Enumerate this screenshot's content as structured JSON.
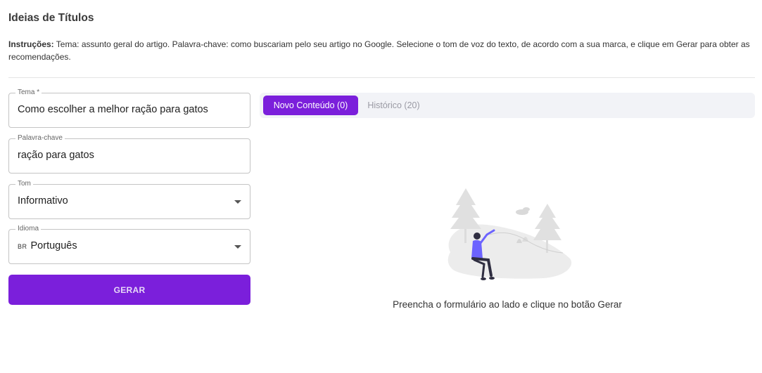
{
  "page": {
    "title": "Ideias de Títulos",
    "instructions_label": "Instruções:",
    "instructions_text": " Tema: assunto geral do artigo. Palavra-chave: como buscariam pelo seu artigo no Google. Selecione o tom de voz do texto, de acordo com a sua marca, e clique em Gerar para obter as recomendações."
  },
  "form": {
    "tema": {
      "label": "Tema *",
      "value": "Como escolher a melhor ração para gatos"
    },
    "palavra_chave": {
      "label": "Palavra-chave",
      "value": "ração para gatos"
    },
    "tom": {
      "label": "Tom",
      "value": "Informativo"
    },
    "idioma": {
      "label": "Idioma",
      "flag": "BR",
      "value": "Português"
    },
    "submit_label": "GERAR"
  },
  "tabs": [
    {
      "label": "Novo Conteúdo (0)",
      "active": true
    },
    {
      "label": "Histórico (20)",
      "active": false
    }
  ],
  "empty_state": {
    "illustration": "person-sitting-flying-kite-illustration",
    "message": "Preencha o formulário ao lado e clique no botão Gerar"
  },
  "colors": {
    "accent": "#7b1fdb",
    "tabs_background": "#f2f3f7",
    "border": "#c4c4c4"
  }
}
